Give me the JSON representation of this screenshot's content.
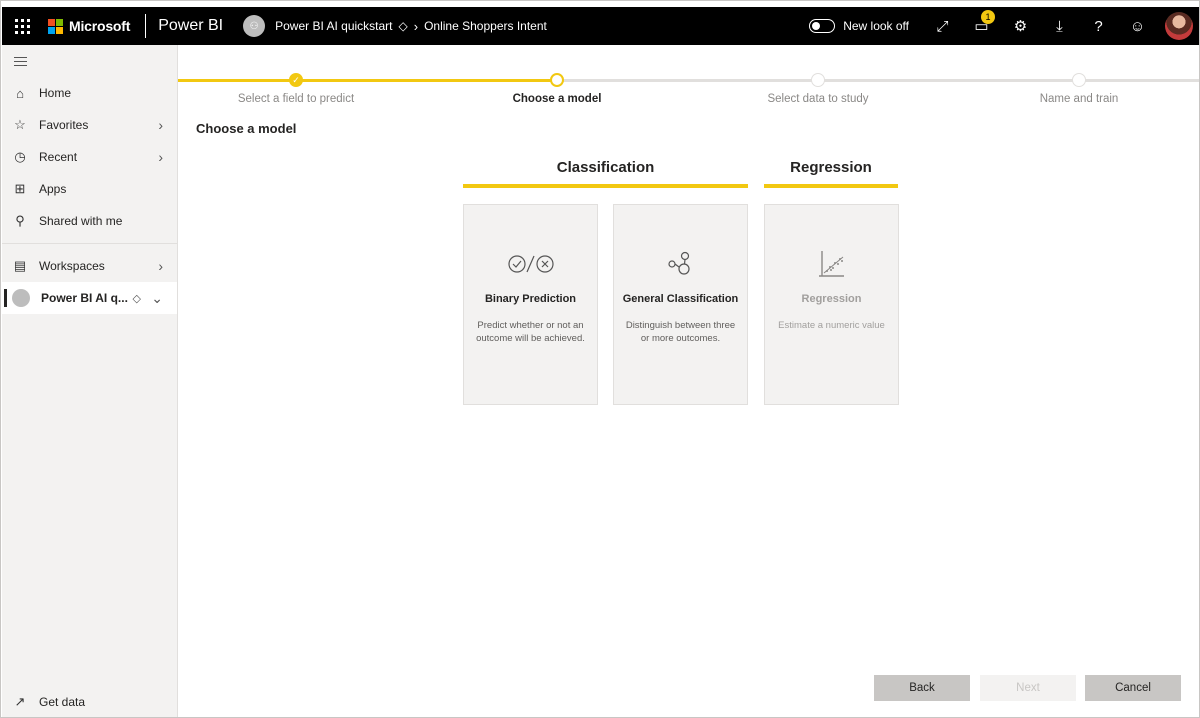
{
  "topbar": {
    "brand": "Microsoft",
    "app": "Power BI",
    "workspace": "Power BI AI quickstart",
    "report": "Online Shoppers Intent",
    "new_look": "New look off",
    "notification_count": "1",
    "colors": {
      "brand_accent": "#f2c811",
      "bar_bg": "#000000"
    }
  },
  "sidebar": {
    "items": [
      {
        "label": "Home",
        "icon": "home-icon"
      },
      {
        "label": "Favorites",
        "icon": "star-icon"
      },
      {
        "label": "Recent",
        "icon": "clock-icon"
      },
      {
        "label": "Apps",
        "icon": "apps-icon"
      },
      {
        "label": "Shared with me",
        "icon": "shared-icon"
      },
      {
        "label": "Workspaces",
        "icon": "workspaces-icon"
      },
      {
        "label": "Power BI AI q...",
        "icon": "workspace-avatar-icon"
      }
    ],
    "get_data": "Get data"
  },
  "wizard": {
    "steps": [
      {
        "label": "Select a field to predict",
        "state": "done"
      },
      {
        "label": "Choose a model",
        "state": "current"
      },
      {
        "label": "Select data to study",
        "state": "pending"
      },
      {
        "label": "Name and train",
        "state": "pending"
      }
    ],
    "title": "Choose a model",
    "categories": {
      "classification": "Classification",
      "regression": "Regression"
    },
    "cards": [
      {
        "title": "Binary Prediction",
        "desc": "Predict whether or not an outcome will be achieved.",
        "icon": "check-x-icon",
        "enabled": true
      },
      {
        "title": "General Classification",
        "desc": "Distinguish between three or more outcomes.",
        "icon": "nodes-icon",
        "enabled": true
      },
      {
        "title": "Regression",
        "desc": "Estimate a numeric value",
        "icon": "scatter-plot-icon",
        "enabled": false
      }
    ],
    "buttons": {
      "back": "Back",
      "next": "Next",
      "cancel": "Cancel"
    }
  }
}
